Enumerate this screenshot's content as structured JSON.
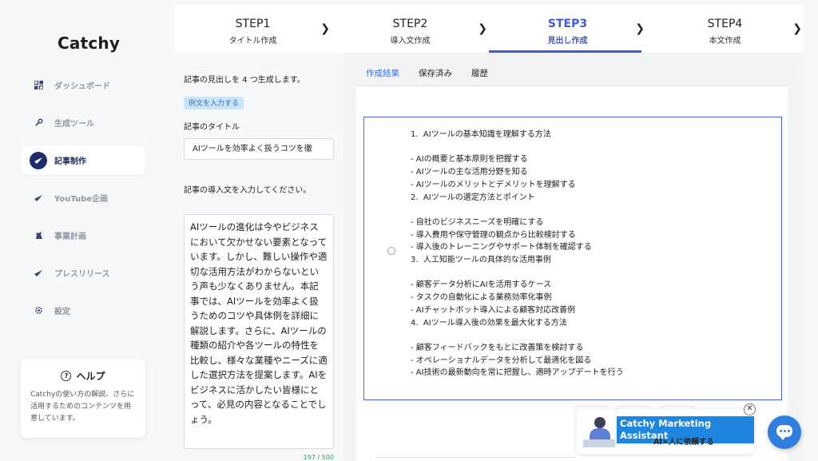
{
  "app": {
    "logo": "Catchy"
  },
  "sidebar": {
    "items": [
      {
        "label": "ダッシュボード",
        "icon": "dashboard-icon",
        "active": false
      },
      {
        "label": "生成ツール",
        "icon": "tool-icon",
        "active": false
      },
      {
        "label": "記事制作",
        "icon": "article-icon",
        "active": true
      },
      {
        "label": "YouTube企画",
        "icon": "youtube-icon",
        "active": false
      },
      {
        "label": "事業計画",
        "icon": "business-icon",
        "active": false
      },
      {
        "label": "プレスリリース",
        "icon": "press-icon",
        "active": false
      },
      {
        "label": "設定",
        "icon": "gear-icon",
        "active": false
      }
    ],
    "help": {
      "title": "ヘルプ",
      "text": "Catchyの使い方の解説、さらに活用するためのコンテンツを用意しています。"
    }
  },
  "steps": [
    {
      "title": "STEP1",
      "sub": "タイトル作成",
      "active": false
    },
    {
      "title": "STEP2",
      "sub": "導入文作成",
      "active": false
    },
    {
      "title": "STEP3",
      "sub": "見出し作成",
      "active": true
    },
    {
      "title": "STEP4",
      "sub": "本文作成",
      "active": false
    }
  ],
  "form": {
    "description": "記事の見出しを 4 つ生成します。",
    "example_button": "例文を入力する",
    "title_label": "記事のタイトル",
    "title_value": "AIツールを効率よく扱うコツを徹",
    "intro_label": "記事の導入文を入力してください。",
    "intro_value": "AIツールの進化は今やビジネスにおいて欠かせない要素となっています。しかし、難しい操作や適切な活用方法がわからないという声も少なくありません。本記事では、AIツールを効率よく扱うためのコツや具体例を詳細に解説します。さらに、AIツールの種類の紹介や各ツールの特性を比較し、様々な業種やニーズに適した選択方法を提案します。AIをビジネスに活かしたい皆様にとって、必見の内容となることでしょう。",
    "counter": "197 / 500"
  },
  "result_tabs": [
    {
      "label": "作成結果",
      "active": true
    },
    {
      "label": "保存済み",
      "active": false
    },
    {
      "label": "履歴",
      "active": false
    }
  ],
  "result": {
    "outline": "1.  AIツールの基本知識を理解する方法\n\n- AIの概要と基本原則を把握する\n- AIツールの主な活用分野を知る\n- AIツールのメリットとデメリットを理解する\n2.  AIツールの選定方法とポイント\n\n- 自社のビジネスニーズを明確にする\n- 導入費用や保守管理の観点から比較検討する\n- 導入後のトレーニングやサポート体制を確認する\n3.  人工知能ツールの具体的な活用事例\n\n- 顧客データ分析にAIを活用するケース\n- タスクの自動化による業務効率化事例\n- AIチャットボット導入による顧客対応改善例\n4.  AIツール導入後の効果を最大化する方法\n\n- 顧客フィードバックをもとに改善策を検討する\n- オペレーショナルデータを分析して最適化を図る\n- AI技術の最新動向を常に把握し、適時アップデートを行う"
  },
  "assistant": {
    "label": "Catchy Marketing Assistant",
    "sub": "AI×人に依頼する",
    "close": "✕"
  },
  "colors": {
    "accent": "#3b5bdb",
    "nav_active": "#1f2b6b",
    "chat": "#2f7ee0"
  }
}
